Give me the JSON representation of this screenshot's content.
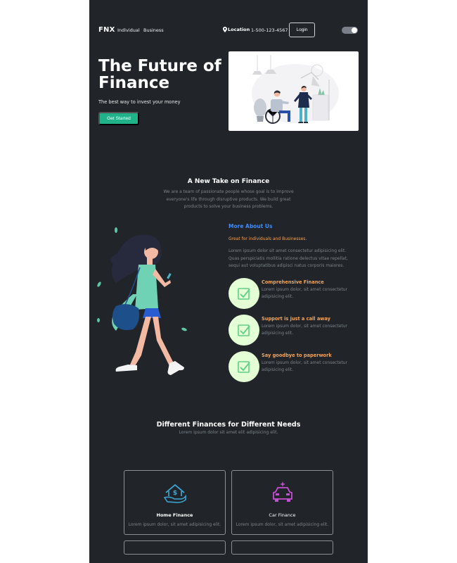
{
  "nav": {
    "brand": "FNX",
    "links": [
      "Individual",
      "Business"
    ],
    "location": "Location",
    "phone": "1-500-123-4567",
    "login": "Login"
  },
  "hero": {
    "title": "The Future of Finance",
    "subtitle": "The best way to invest your money",
    "cta": "Get Started"
  },
  "take": {
    "title": "A New Take on Finance",
    "text": "We are a team of passionate people whose goal is to improve everyone's life through disruptive products. We build great products to solve your business problems."
  },
  "about": {
    "title": "More About Us",
    "tagline": "Great for individuals and Businesses.",
    "text": "Lorem ipsum dolor sit amet consectetur adipisicing elit. Quas perspiciatis mollitia ratione delectus vitae repellat, sequi aut voluptatibus adipisci natus corporis maiores.",
    "features": [
      {
        "title": "Comprehensive Finance",
        "text": "Lorem ipsum dolor, sit amet consectetur adipisicing elit."
      },
      {
        "title": "Support is just a call away",
        "text": "Lorem ipsum dolor, sit amet consectetur adipisicing elit."
      },
      {
        "title": "Say goodbye to paperwork",
        "text": "Lorem ipsum dolor, sit amet consectetur adipisicing elit."
      }
    ]
  },
  "needs": {
    "title": "Different Finances for Different Needs",
    "subtitle": "Lorem ipsum dolor sit amet elit adipisicing elit.",
    "cards": [
      {
        "title": "Home Finance",
        "text": "Lorem ipsum dolor, sit amet adipisicing elit.",
        "icon": "home-finance-icon"
      },
      {
        "title": "Car Finance",
        "text": "Lorem ipsum dolor, sit amet adipisicing elit.",
        "icon": "car-finance-icon"
      }
    ]
  },
  "colors": {
    "page_bg": "#212529",
    "accent_green": "#20b38a",
    "about_blue": "#3d8bfd",
    "feature_orange": "#f0a45c",
    "check_circle": "#e4ffd6"
  }
}
